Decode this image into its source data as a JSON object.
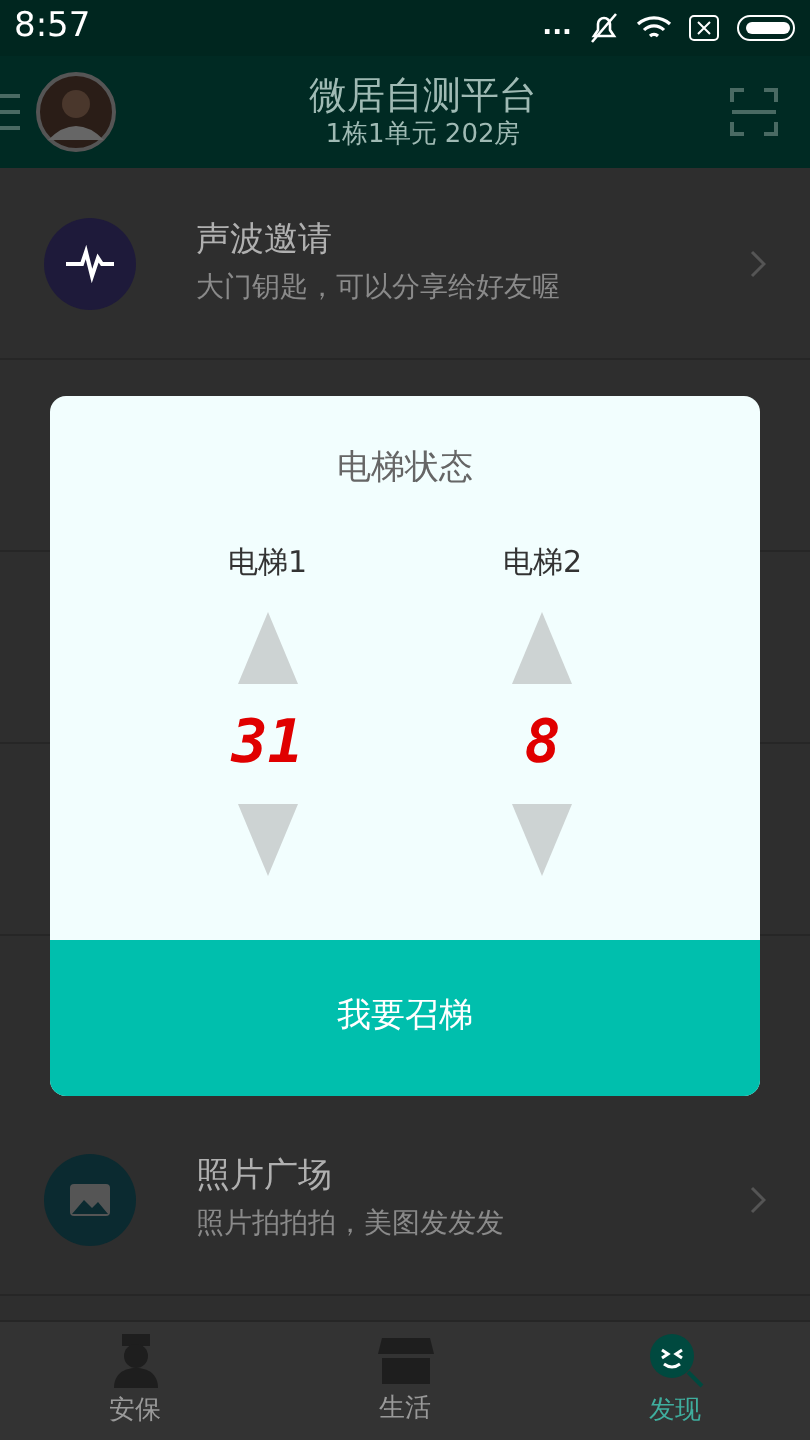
{
  "status_bar": {
    "time": "8:57",
    "dots": "..."
  },
  "header": {
    "title": "微居自测平台",
    "subtitle": "1栋1单元 202房"
  },
  "list": [
    {
      "kind": "sound",
      "title": "声波邀请",
      "subtitle": "大门钥匙，可以分享给好友喔"
    },
    {
      "kind": "photo",
      "title": "照片广场",
      "subtitle": "照片拍拍拍，美图发发发"
    }
  ],
  "dialog": {
    "title": "电梯状态",
    "elevators": [
      {
        "label": "电梯1",
        "floor": "31"
      },
      {
        "label": "电梯2",
        "floor": "8"
      }
    ],
    "button": "我要召梯"
  },
  "tabs": [
    {
      "kind": "guard",
      "label": "安保",
      "selected": false
    },
    {
      "kind": "life",
      "label": "生活",
      "selected": false
    },
    {
      "kind": "discover",
      "label": "发现",
      "selected": true
    }
  ]
}
